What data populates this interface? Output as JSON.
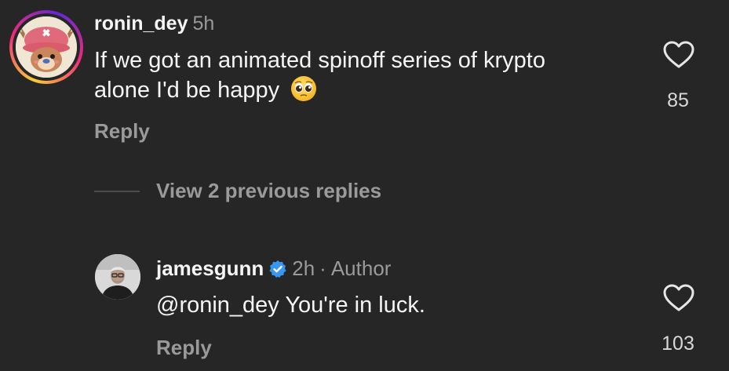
{
  "comment_1": {
    "username": "ronin_dey",
    "time": "5h",
    "text": "If we got an animated spinoff series of krypto alone I'd be happy",
    "emoji": "pleading-face",
    "reply_label": "Reply",
    "likes": "85"
  },
  "view_replies": {
    "label": "View 2 previous replies"
  },
  "comment_2": {
    "username": "jamesgunn",
    "verified": true,
    "time": "2h",
    "separator": "·",
    "author_label": "Author",
    "text": "@ronin_dey You're in luck.",
    "reply_label": "Reply",
    "likes": "103"
  },
  "colors": {
    "background": "#262626",
    "primary_text": "#f5f5f5",
    "secondary_text": "#9a9a9a",
    "verified_blue": "#3897f0"
  }
}
